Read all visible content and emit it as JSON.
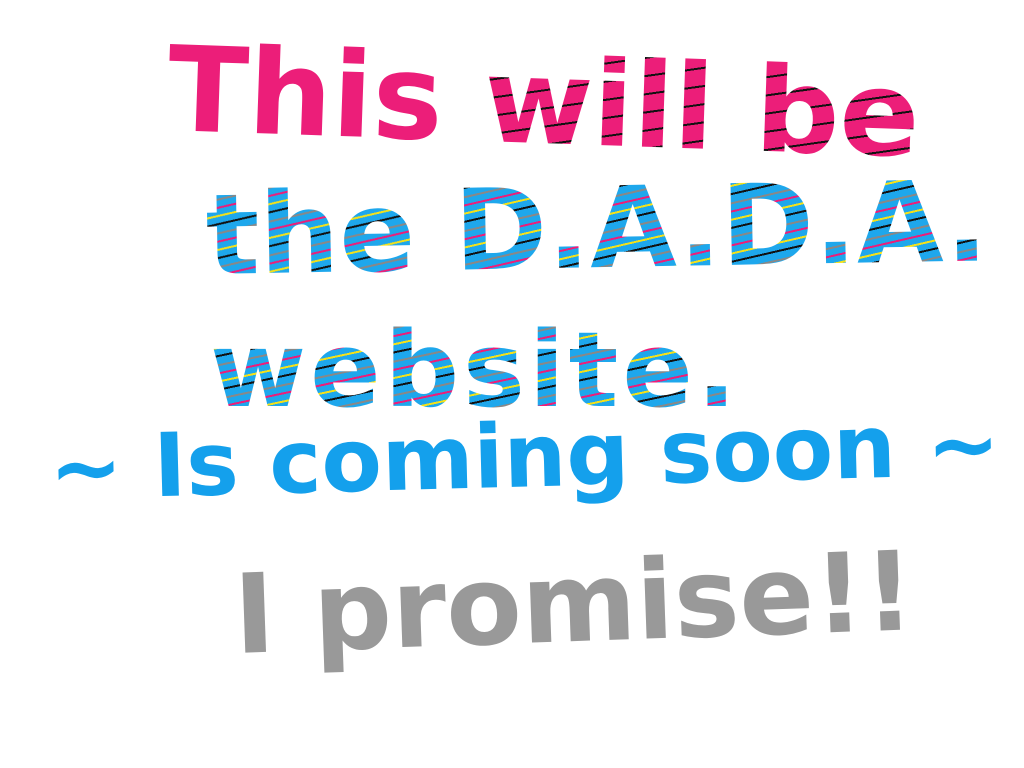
{
  "lines": {
    "line1": {
      "part1": "This",
      "part2": "will be"
    },
    "line2": {
      "part1": "the",
      "part2": "D.A.D.A."
    },
    "line3": "website.",
    "line4": "~ Is coming soon ~",
    "line5": "I promise!!"
  },
  "colors": {
    "pink": "#ec1e79",
    "blue": "#14a0ec",
    "gray": "#999999",
    "yellow": "#f4e11a",
    "black": "#111111",
    "background": "#ffffff"
  }
}
